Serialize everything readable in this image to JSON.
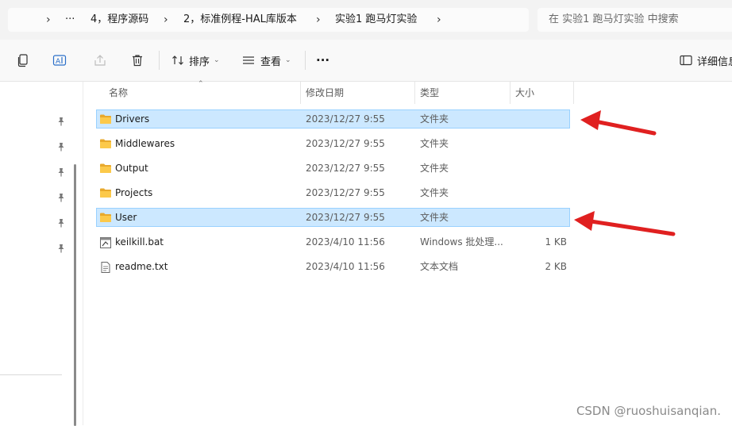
{
  "address_bar": {
    "crumbs": [
      "4，程序源码",
      "2，标准例程-HAL库版本",
      "实验1 跑马灯实验"
    ],
    "more": "···"
  },
  "search": {
    "placeholder": "在 实验1 跑马灯实验 中搜索"
  },
  "command_bar": {
    "sort_label": "排序",
    "view_label": "查看",
    "more_label": "···",
    "details_label": "详细信息"
  },
  "columns": {
    "name": "名称",
    "date": "修改日期",
    "type": "类型",
    "size": "大小"
  },
  "files": [
    {
      "name": "Drivers",
      "date": "2023/12/27 9:55",
      "type": "文件夹",
      "size": "",
      "icon": "folder-icon",
      "selected": true
    },
    {
      "name": "Middlewares",
      "date": "2023/12/27 9:55",
      "type": "文件夹",
      "size": "",
      "icon": "folder-icon",
      "selected": false
    },
    {
      "name": "Output",
      "date": "2023/12/27 9:55",
      "type": "文件夹",
      "size": "",
      "icon": "folder-icon",
      "selected": false
    },
    {
      "name": "Projects",
      "date": "2023/12/27 9:55",
      "type": "文件夹",
      "size": "",
      "icon": "folder-icon",
      "selected": false
    },
    {
      "name": "User",
      "date": "2023/12/27 9:55",
      "type": "文件夹",
      "size": "",
      "icon": "folder-icon",
      "selected": true
    },
    {
      "name": "keilkill.bat",
      "date": "2023/4/10 11:56",
      "type": "Windows 批处理...",
      "size": "1 KB",
      "icon": "batch-file-icon",
      "selected": false
    },
    {
      "name": "readme.txt",
      "date": "2023/4/10 11:56",
      "type": "文本文档",
      "size": "2 KB",
      "icon": "text-file-icon",
      "selected": false
    }
  ],
  "annotation_color": "#e02020",
  "selection_color": "#cce8ff",
  "watermark": "CSDN @ruoshuisanqian."
}
